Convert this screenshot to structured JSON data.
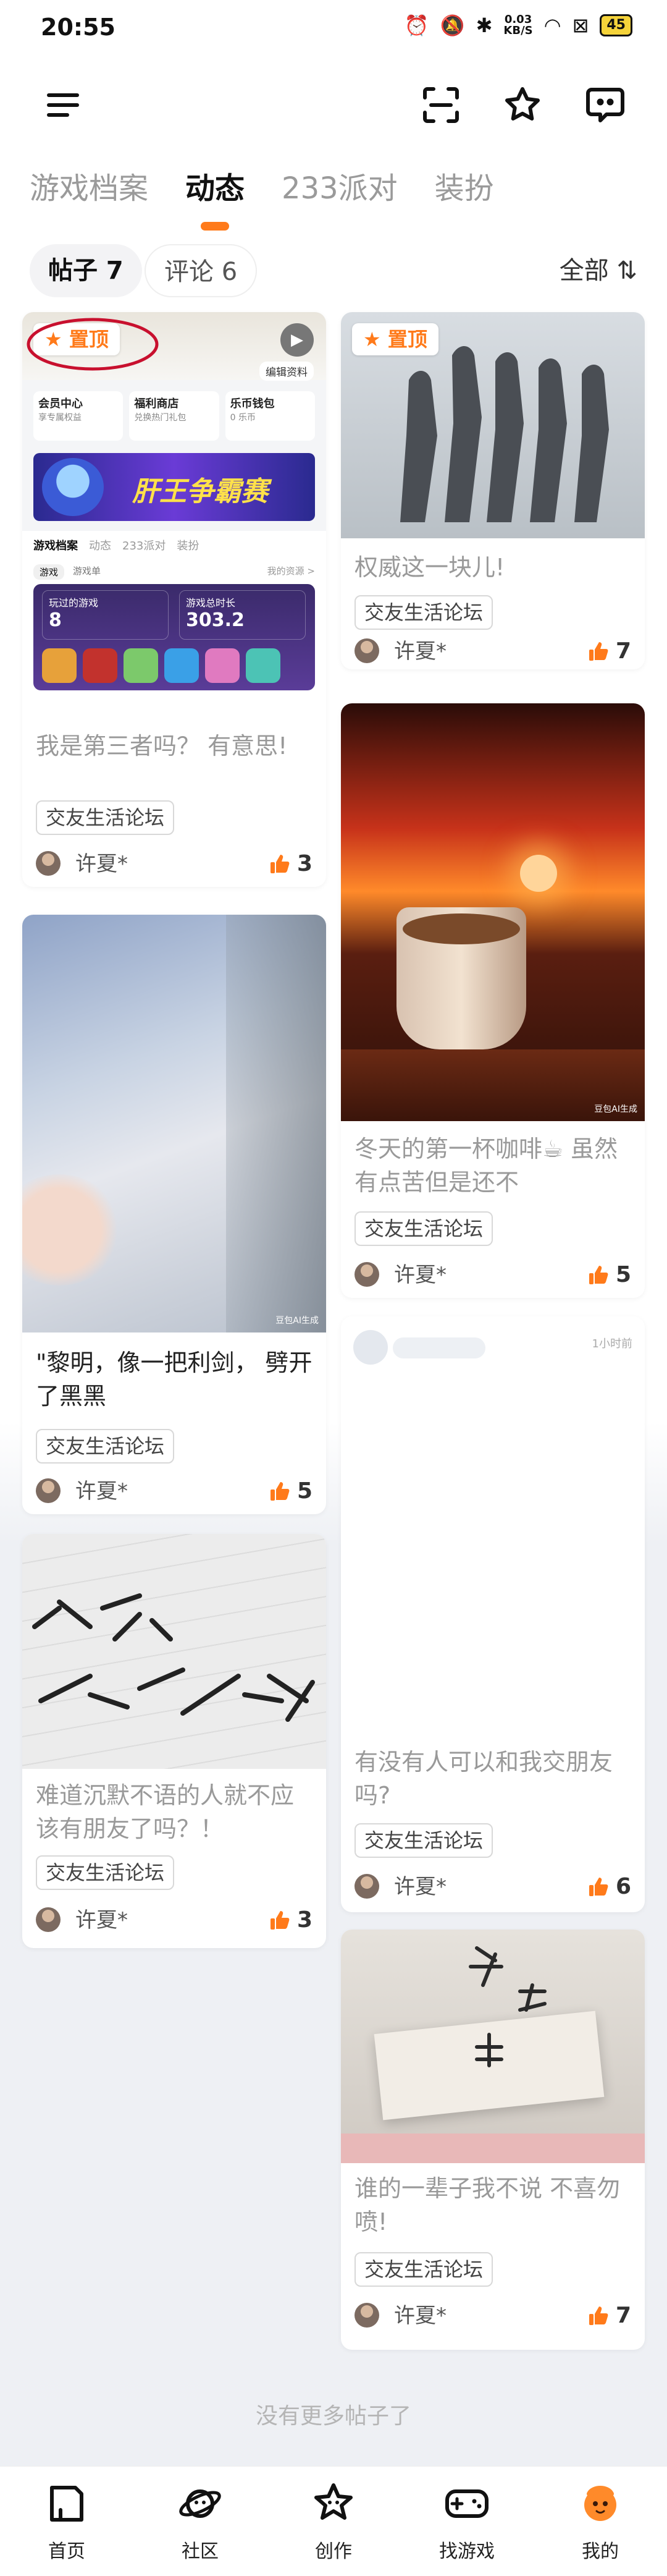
{
  "status": {
    "time": "20:55",
    "net_speed": "0.03",
    "net_unit": "KB/S",
    "battery": "45"
  },
  "tabs": [
    {
      "label": "游戏档案"
    },
    {
      "label": "动态"
    },
    {
      "label": "233派对"
    },
    {
      "label": "装扮"
    }
  ],
  "filter": {
    "posts": "帖子 7",
    "comments": "评论 6",
    "sort": "全部 ⇅"
  },
  "pinned_label": "置顶",
  "posts": [
    {
      "text": "我是第三者吗？ 有意思!",
      "tag": "交友生活论坛",
      "author": "许夏*",
      "likes": "3"
    },
    {
      "text": "\"黎明，像一把利剑， 劈开了黑黑",
      "tag": "交友生活论坛",
      "author": "许夏*",
      "likes": "5"
    },
    {
      "text": "难道沉默不语的人就不应该有朋友了吗？！",
      "tag": "交友生活论坛",
      "author": "许夏*",
      "likes": "3"
    },
    {
      "text": "权威这一块儿!",
      "tag": "交友生活论坛",
      "author": "许夏*",
      "likes": "7"
    },
    {
      "text": "冬天的第一杯咖啡☕ 虽然有点苦但是还不",
      "tag": "交友生活论坛",
      "author": "许夏*",
      "likes": "5"
    },
    {
      "text": "有没有人可以和我交朋友吗?",
      "tag": "交友生活论坛",
      "author": "许夏*",
      "likes": "6",
      "time": "1小时前"
    },
    {
      "text": "谁的一辈子我不说 不喜勿喷!",
      "tag": "交友生活论坛",
      "author": "许夏*",
      "likes": "7"
    }
  ],
  "screenshot_card": {
    "edit": "编辑资料",
    "menu": [
      "会员中心",
      "福利商店",
      "乐币钱包"
    ],
    "menu_sub": [
      "享专属权益",
      "兑换热门礼包",
      "0 乐币"
    ],
    "banner": "肝王争霸赛",
    "mini_tabs": [
      "游戏档案",
      "动态",
      "233派对",
      "装扮"
    ],
    "mini_sub": [
      "游戏",
      "游戏单"
    ],
    "mini_res": "我的资源 >",
    "stat1_label": "玩过的游戏",
    "stat1_value": "8",
    "stat2_label": "游戏总时长",
    "stat2_value": "303.2"
  },
  "watermark": "豆包AI生成",
  "end_text": "没有更多帖子了",
  "nav": [
    {
      "label": "首页"
    },
    {
      "label": "社区"
    },
    {
      "label": "创作"
    },
    {
      "label": "找游戏"
    },
    {
      "label": "我的"
    }
  ],
  "colors": {
    "accent": "#ff7a1a"
  }
}
